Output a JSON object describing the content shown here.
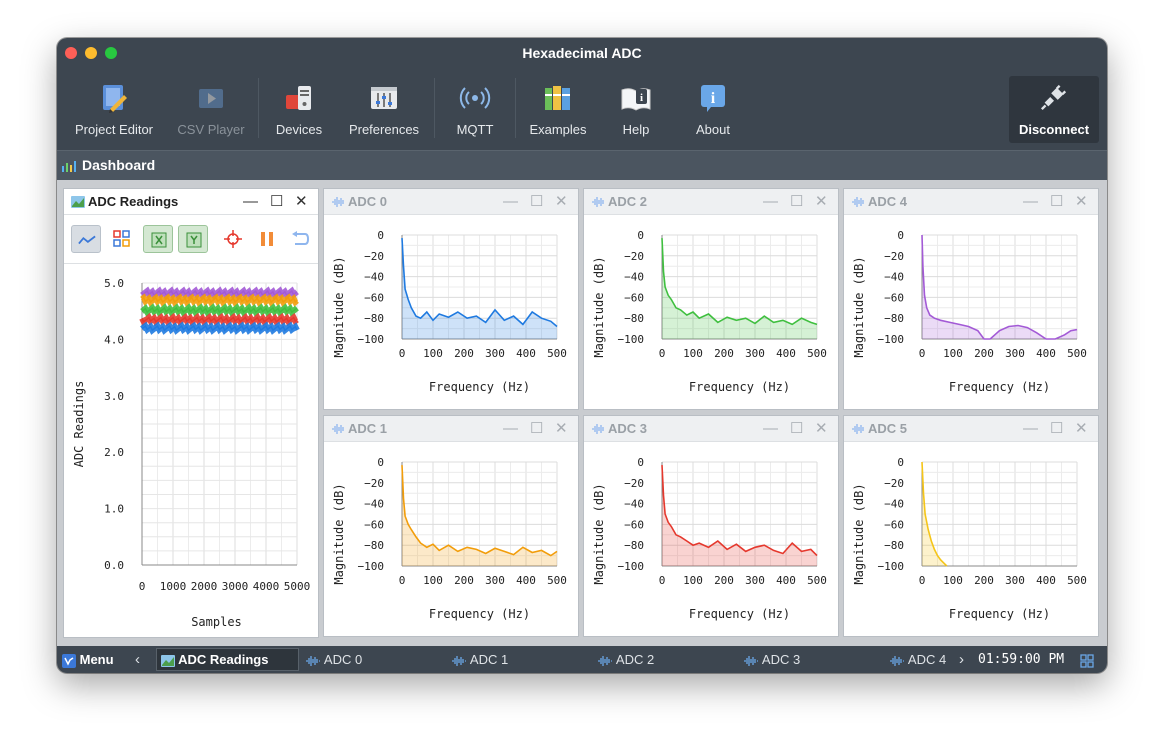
{
  "window": {
    "title": "Hexadecimal ADC"
  },
  "toolbar": {
    "project_editor": "Project Editor",
    "csv_player": "CSV Player",
    "devices": "Devices",
    "preferences": "Preferences",
    "mqtt": "MQTT",
    "examples": "Examples",
    "help": "Help",
    "about": "About",
    "disconnect": "Disconnect"
  },
  "dashboard": {
    "label": "Dashboard"
  },
  "main_panel": {
    "title": "ADC Readings",
    "ylabel": "ADC Readings",
    "xlabel": "Samples"
  },
  "fft_panels": [
    {
      "title": "ADC 0",
      "ylabel": "Magnitude (dB)",
      "xlabel": "Frequency (Hz)",
      "color": "#1f7ae0"
    },
    {
      "title": "ADC 2",
      "ylabel": "Magnitude (dB)",
      "xlabel": "Frequency (Hz)",
      "color": "#3fbf3f"
    },
    {
      "title": "ADC 4",
      "ylabel": "Magnitude (dB)",
      "xlabel": "Frequency (Hz)",
      "color": "#a35ad6"
    },
    {
      "title": "ADC 1",
      "ylabel": "Magnitude (dB)",
      "xlabel": "Frequency (Hz)",
      "color": "#f29d0a"
    },
    {
      "title": "ADC 3",
      "ylabel": "Magnitude (dB)",
      "xlabel": "Frequency (Hz)",
      "color": "#e5382d"
    },
    {
      "title": "ADC 5",
      "ylabel": "Magnitude (dB)",
      "xlabel": "Frequency (Hz)",
      "color": "#f5c518"
    }
  ],
  "taskbar": {
    "menu": "Menu",
    "items": [
      "ADC Readings",
      "ADC 0",
      "ADC 1",
      "ADC 2",
      "ADC 3",
      "ADC 4"
    ],
    "clock": "01:59:00 PM"
  },
  "chart_data": [
    {
      "type": "line",
      "title": "ADC Readings",
      "xlabel": "Samples",
      "ylabel": "ADC Readings",
      "xlim": [
        0,
        5000
      ],
      "ylim": [
        0,
        5
      ],
      "xticks": [
        "0",
        "1000",
        "2000",
        "3000",
        "4000",
        "5000"
      ],
      "yticks": [
        "0.0",
        "1.0",
        "2.0",
        "3.0",
        "4.0",
        "5.0"
      ],
      "series": [
        {
          "values": [
            4.82,
            4.82,
            4.82,
            4.82,
            4.82,
            4.82
          ],
          "color": "#a35ad6"
        },
        {
          "values": [
            4.7,
            4.7,
            4.7,
            4.7,
            4.7,
            4.7
          ],
          "color": "#f29d0a"
        },
        {
          "values": [
            4.52,
            4.52,
            4.52,
            4.52,
            4.52,
            4.52
          ],
          "color": "#3fbf3f"
        },
        {
          "values": [
            4.35,
            4.35,
            4.35,
            4.35,
            4.35,
            4.35
          ],
          "color": "#e5382d"
        },
        {
          "values": [
            4.2,
            4.2,
            4.2,
            4.2,
            4.2,
            4.2
          ],
          "color": "#1f7ae0"
        }
      ]
    },
    {
      "type": "area",
      "title": "ADC 0",
      "xlabel": "Frequency (Hz)",
      "ylabel": "Magnitude (dB)",
      "xlim": [
        0,
        500
      ],
      "ylim": [
        -100,
        0
      ],
      "x": [
        0,
        5,
        10,
        20,
        30,
        45,
        60,
        80,
        100,
        120,
        150,
        180,
        210,
        240,
        270,
        300,
        330,
        360,
        390,
        420,
        450,
        480,
        500
      ],
      "values": [
        -3,
        -30,
        -52,
        -62,
        -70,
        -78,
        -80,
        -74,
        -82,
        -76,
        -79,
        -74,
        -80,
        -78,
        -84,
        -72,
        -82,
        -78,
        -86,
        -74,
        -80,
        -83,
        -88
      ]
    },
    {
      "type": "area",
      "title": "ADC 2",
      "xlabel": "Frequency (Hz)",
      "ylabel": "Magnitude (dB)",
      "xlim": [
        0,
        500
      ],
      "ylim": [
        -100,
        0
      ],
      "x": [
        0,
        5,
        10,
        20,
        30,
        45,
        60,
        80,
        100,
        120,
        150,
        180,
        210,
        240,
        270,
        300,
        330,
        360,
        390,
        420,
        450,
        480,
        500
      ],
      "values": [
        -3,
        -35,
        -50,
        -58,
        -62,
        -70,
        -72,
        -77,
        -74,
        -80,
        -76,
        -84,
        -79,
        -82,
        -80,
        -85,
        -78,
        -84,
        -82,
        -86,
        -80,
        -84,
        -86
      ]
    },
    {
      "type": "area",
      "title": "ADC 4",
      "xlabel": "Frequency (Hz)",
      "ylabel": "Magnitude (dB)",
      "xlim": [
        0,
        500
      ],
      "ylim": [
        -100,
        0
      ],
      "x": [
        0,
        3,
        8,
        15,
        25,
        40,
        60,
        90,
        120,
        150,
        180,
        200,
        220,
        250,
        280,
        310,
        340,
        370,
        400,
        430,
        460,
        480,
        500
      ],
      "values": [
        0,
        -30,
        -58,
        -70,
        -77,
        -80,
        -82,
        -84,
        -86,
        -88,
        -92,
        -100,
        -100,
        -92,
        -88,
        -87,
        -89,
        -94,
        -100,
        -100,
        -96,
        -92,
        -91
      ]
    },
    {
      "type": "area",
      "title": "ADC 1",
      "xlabel": "Frequency (Hz)",
      "ylabel": "Magnitude (dB)",
      "xlim": [
        0,
        500
      ],
      "ylim": [
        -100,
        0
      ],
      "x": [
        0,
        5,
        10,
        20,
        30,
        45,
        60,
        80,
        100,
        120,
        150,
        180,
        210,
        240,
        270,
        300,
        330,
        360,
        390,
        420,
        450,
        480,
        500
      ],
      "values": [
        -3,
        -35,
        -52,
        -60,
        -65,
        -72,
        -78,
        -82,
        -79,
        -85,
        -80,
        -86,
        -82,
        -84,
        -88,
        -83,
        -86,
        -89,
        -82,
        -87,
        -85,
        -90,
        -86
      ]
    },
    {
      "type": "area",
      "title": "ADC 3",
      "xlabel": "Frequency (Hz)",
      "ylabel": "Magnitude (dB)",
      "xlim": [
        0,
        500
      ],
      "ylim": [
        -100,
        0
      ],
      "x": [
        0,
        5,
        10,
        20,
        30,
        45,
        60,
        80,
        100,
        120,
        150,
        180,
        210,
        240,
        270,
        300,
        330,
        360,
        390,
        420,
        450,
        480,
        500
      ],
      "values": [
        -3,
        -32,
        -50,
        -58,
        -62,
        -70,
        -72,
        -76,
        -80,
        -78,
        -82,
        -76,
        -84,
        -79,
        -86,
        -82,
        -80,
        -85,
        -88,
        -78,
        -86,
        -84,
        -90
      ]
    },
    {
      "type": "area",
      "title": "ADC 5",
      "xlabel": "Frequency (Hz)",
      "ylabel": "Magnitude (dB)",
      "xlim": [
        0,
        500
      ],
      "ylim": [
        -100,
        0
      ],
      "x": [
        0,
        5,
        10,
        20,
        30,
        40,
        50,
        60,
        70,
        80
      ],
      "values": [
        0,
        -30,
        -50,
        -65,
        -76,
        -84,
        -90,
        -94,
        -97,
        -100
      ]
    }
  ]
}
